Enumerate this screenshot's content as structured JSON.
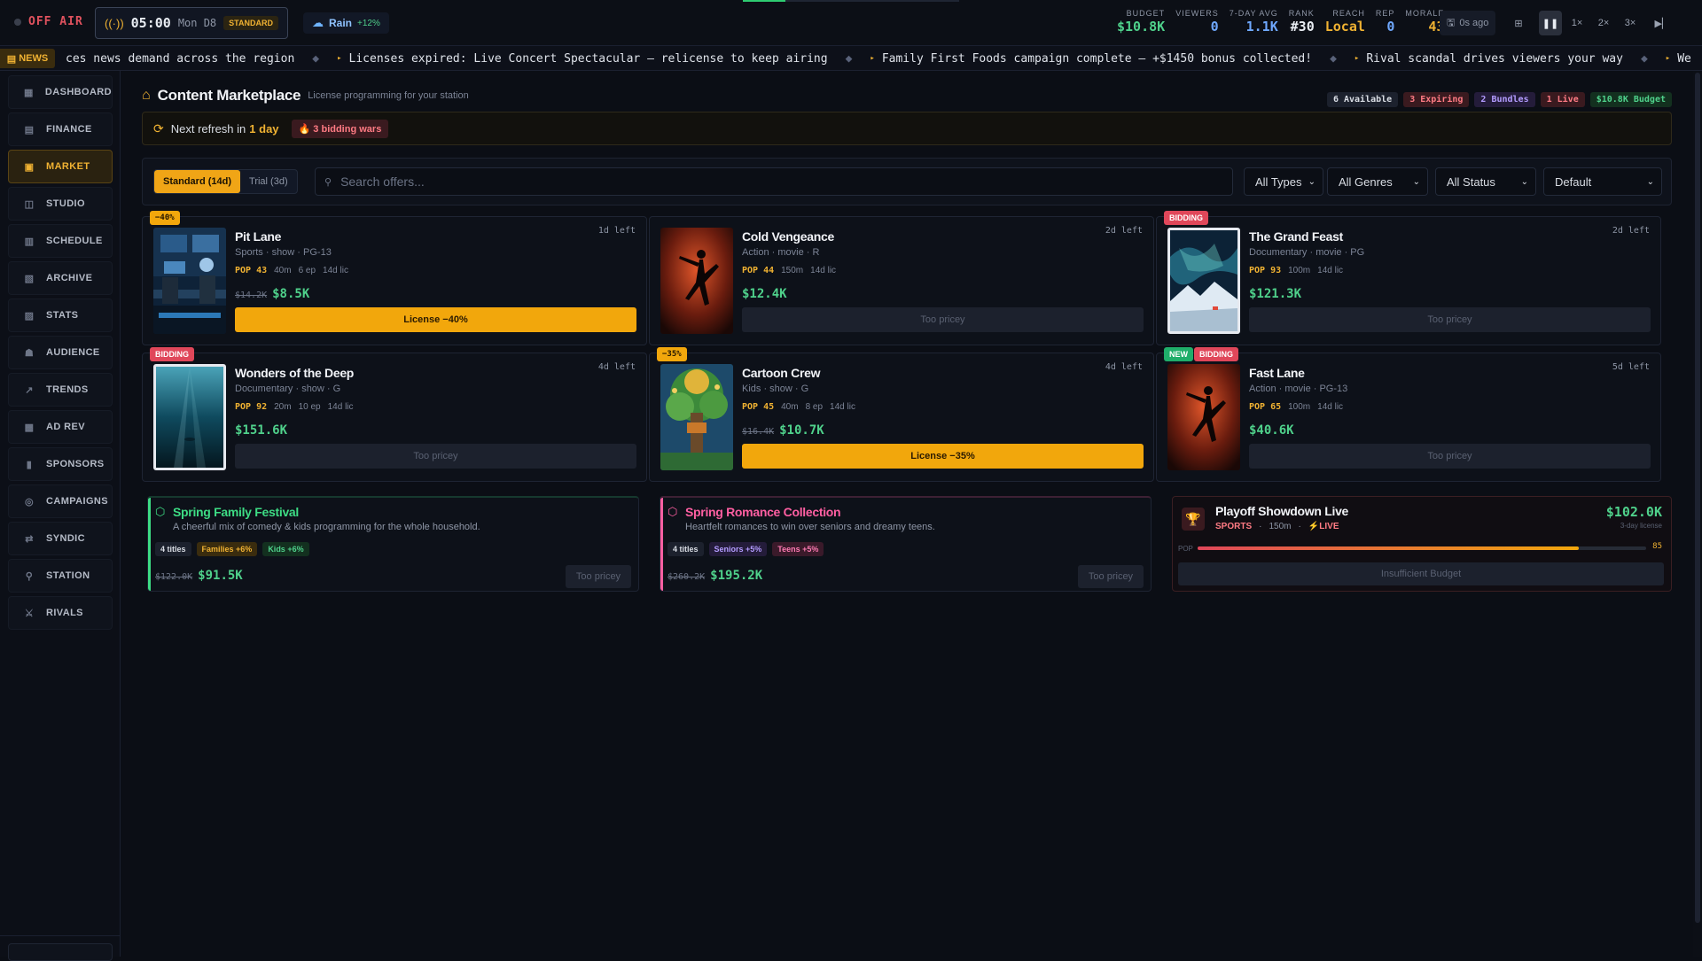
{
  "topbar": {
    "status": "OFF AIR",
    "time": "05:00",
    "day": "Mon D8",
    "tier": "STANDARD",
    "weather": {
      "label": "Rain",
      "delta": "+12%",
      "icon": "cloud-rain-icon"
    },
    "stats": [
      {
        "key": "BUDGET",
        "value": "$10.8K",
        "color": "#4fd18b"
      },
      {
        "key": "VIEWERS",
        "value": "0",
        "color": "#6fa8ff"
      },
      {
        "key": "7-DAY AVG",
        "value": "1.1K",
        "color": "#6fa8ff"
      },
      {
        "key": "RANK",
        "value": "#30",
        "color": "#e9edf3"
      },
      {
        "key": "REACH",
        "value": "Local",
        "color": "#f0b232"
      },
      {
        "key": "REP",
        "value": "0",
        "color": "#6fa8ff"
      },
      {
        "key": "MORALE",
        "value": "43",
        "color": "#f0b232"
      }
    ],
    "last_save": "0s ago",
    "speeds": [
      "1×",
      "2×",
      "3×"
    ]
  },
  "ticker": {
    "badge": "NEWS",
    "items": [
      "ces news demand across the region",
      "Licenses expired: Live Concert Spectacular — relicense to keep airing",
      "Family First Foods campaign complete — +$1450 bonus collected!",
      "Rival scandal drives viewers your way",
      "We"
    ]
  },
  "sidebar": {
    "items": [
      {
        "label": "DASHBOARD",
        "icon": "dashboard-icon",
        "glyph": "▦"
      },
      {
        "label": "FINANCE",
        "icon": "finance-icon",
        "glyph": "▤"
      },
      {
        "label": "MARKET",
        "icon": "market-icon",
        "glyph": "▣",
        "active": true
      },
      {
        "label": "STUDIO",
        "icon": "studio-icon",
        "glyph": "◫"
      },
      {
        "label": "SCHEDULE",
        "icon": "schedule-icon",
        "glyph": "▥"
      },
      {
        "label": "ARCHIVE",
        "icon": "archive-icon",
        "glyph": "▧"
      },
      {
        "label": "STATS",
        "icon": "stats-icon",
        "glyph": "▨"
      },
      {
        "label": "AUDIENCE",
        "icon": "audience-icon",
        "glyph": "☗"
      },
      {
        "label": "TRENDS",
        "icon": "trends-icon",
        "glyph": "↗"
      },
      {
        "label": "AD REV",
        "icon": "ad-revenue-icon",
        "glyph": "▩"
      },
      {
        "label": "SPONSORS",
        "icon": "sponsors-icon",
        "glyph": "▮"
      },
      {
        "label": "CAMPAIGNS",
        "icon": "campaigns-icon",
        "glyph": "◎"
      },
      {
        "label": "SYNDIC",
        "icon": "syndication-icon",
        "glyph": "⇄"
      },
      {
        "label": "STATION",
        "icon": "station-icon",
        "glyph": "⚲"
      },
      {
        "label": "RIVALS",
        "icon": "rivals-icon",
        "glyph": "⚔"
      }
    ]
  },
  "header": {
    "title": "Content Marketplace",
    "subtitle": "License programming for your station",
    "chips": [
      {
        "label": "6 Available",
        "bg": "#1c212d",
        "fg": "#d9dde4"
      },
      {
        "label": "3 Expiring",
        "bg": "#3a1a1f",
        "fg": "#ff7b84"
      },
      {
        "label": "2 Bundles",
        "bg": "#241c3a",
        "fg": "#b39cff"
      },
      {
        "label": "1 Live",
        "bg": "#3a1a1f",
        "fg": "#ff7b84"
      },
      {
        "label": "$10.8K Budget",
        "bg": "#13301f",
        "fg": "#4fd18b"
      }
    ]
  },
  "refresh": {
    "prefix": "Next refresh in",
    "value": "1 day",
    "bidding": "3 bidding wars"
  },
  "filters": {
    "mode_on": "Standard (14d)",
    "mode_off": "Trial (3d)",
    "search_placeholder": "Search offers...",
    "types": "All Types",
    "genres": "All Genres",
    "status": "All Status",
    "sort": "Default"
  },
  "offers": [
    {
      "title": "Pit Lane",
      "meta": "Sports · show · PG-13",
      "pop": "POP 43",
      "duration": "40m",
      "episodes": "6 ep",
      "license": "14d lic",
      "old": "$14.2K",
      "price": "$8.5K",
      "button": "License −40%",
      "buyable": true,
      "left": "1d left",
      "badges": [
        {
          "t": "−40%",
          "k": "disc"
        }
      ],
      "art": "studio"
    },
    {
      "title": "Cold Vengeance",
      "meta": "Action · movie · R",
      "pop": "POP 44",
      "duration": "150m",
      "episodes": "",
      "license": "14d lic",
      "old": "",
      "price": "$12.4K",
      "button": "Too pricey",
      "buyable": false,
      "left": "2d left",
      "badges": [],
      "art": "fight"
    },
    {
      "title": "The Grand Feast",
      "meta": "Documentary · movie · PG",
      "pop": "POP 93",
      "duration": "100m",
      "episodes": "",
      "license": "14d lic",
      "old": "",
      "price": "$121.3K",
      "button": "Too pricey",
      "buyable": false,
      "left": "2d left",
      "badges": [
        {
          "t": "BIDDING",
          "k": "bid"
        }
      ],
      "art": "aurora",
      "framed": true
    },
    {
      "title": "Wonders of the Deep",
      "meta": "Documentary · show · G",
      "pop": "POP 92",
      "duration": "20m",
      "episodes": "10 ep",
      "license": "14d lic",
      "old": "",
      "price": "$151.6K",
      "button": "Too pricey",
      "buyable": false,
      "left": "4d left",
      "badges": [
        {
          "t": "BIDDING",
          "k": "bid"
        }
      ],
      "art": "ocean",
      "framed": true
    },
    {
      "title": "Cartoon Crew",
      "meta": "Kids · show · G",
      "pop": "POP 45",
      "duration": "40m",
      "episodes": "8 ep",
      "license": "14d lic",
      "old": "$16.4K",
      "price": "$10.7K",
      "button": "License −35%",
      "buyable": true,
      "left": "4d left",
      "badges": [
        {
          "t": "−35%",
          "k": "disc"
        }
      ],
      "art": "tree"
    },
    {
      "title": "Fast Lane",
      "meta": "Action · movie · PG-13",
      "pop": "POP 65",
      "duration": "100m",
      "episodes": "",
      "license": "14d lic",
      "old": "",
      "price": "$40.6K",
      "button": "Too pricey",
      "buyable": false,
      "left": "5d left",
      "badges": [
        {
          "t": "NEW",
          "k": "new"
        },
        {
          "t": "BIDDING",
          "k": "bid"
        }
      ],
      "art": "fight"
    }
  ],
  "bundles": [
    {
      "title": "Spring Family Festival",
      "desc": "A cheerful mix of comedy & kids programming for the whole household.",
      "color": "#3ddc84",
      "titles": "4 titles",
      "tags": [
        {
          "t": "Families +6%",
          "bg": "#3a2c0e",
          "fg": "#f0b232"
        },
        {
          "t": "Kids +6%",
          "bg": "#13301f",
          "fg": "#4fd18b"
        }
      ],
      "old": "$122.0K",
      "price": "$91.5K",
      "button": "Too pricey"
    },
    {
      "title": "Spring Romance Collection",
      "desc": "Heartfelt romances to win over seniors and dreamy teens.",
      "color": "#ff5fa2",
      "titles": "4 titles",
      "tags": [
        {
          "t": "Seniors +5%",
          "bg": "#241c3a",
          "fg": "#b39cff"
        },
        {
          "t": "Teens +5%",
          "bg": "#3a1a2a",
          "fg": "#ff7bb4"
        }
      ],
      "old": "$260.2K",
      "price": "$195.2K",
      "button": "Too pricey"
    }
  ],
  "live": {
    "title": "Playoff Showdown Live",
    "genre": "SPORTS",
    "duration": "150m",
    "live_label": "LIVE",
    "price": "$102.0K",
    "license": "3-day license",
    "pop_label": "POP",
    "pop": 85,
    "pop_text": "85",
    "button": "Insufficient Budget"
  }
}
